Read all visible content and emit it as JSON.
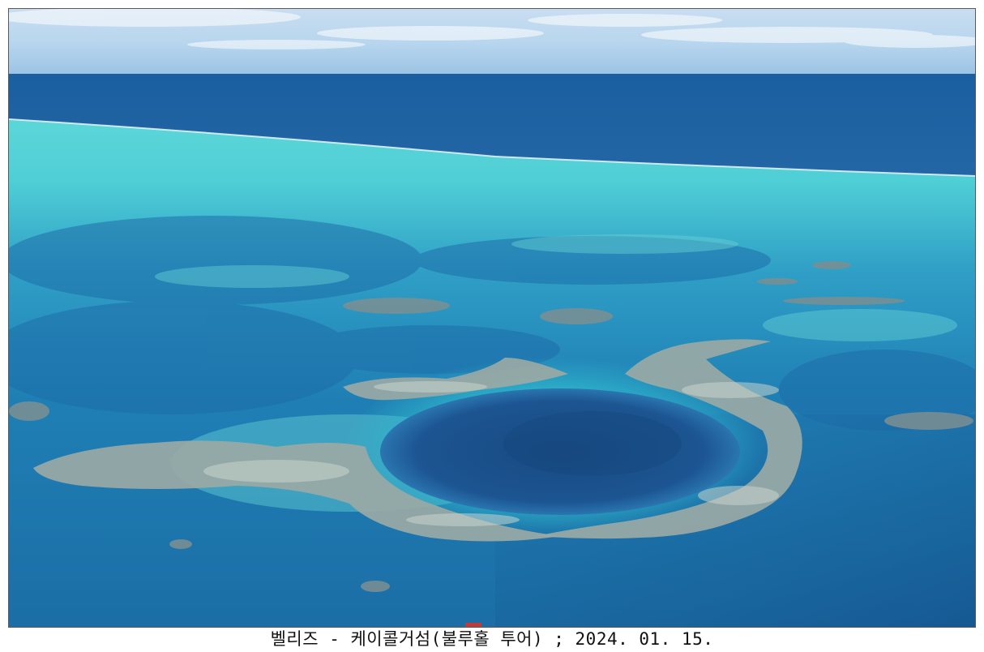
{
  "photo": {
    "subject": "aerial-ocean-blue-hole",
    "colors": {
      "sky": "#b8d6ee",
      "deep_ocean": "#1d5f98",
      "lagoon_light": "#5fd3d6",
      "lagoon_mid": "#2aa6c4",
      "reef": "#8fa7a8",
      "hole": "#1b4e8a"
    }
  },
  "caption": {
    "text": "벨리즈 - 케이콜거섬(불루홀 투어) ; 2024. 01. 15."
  }
}
